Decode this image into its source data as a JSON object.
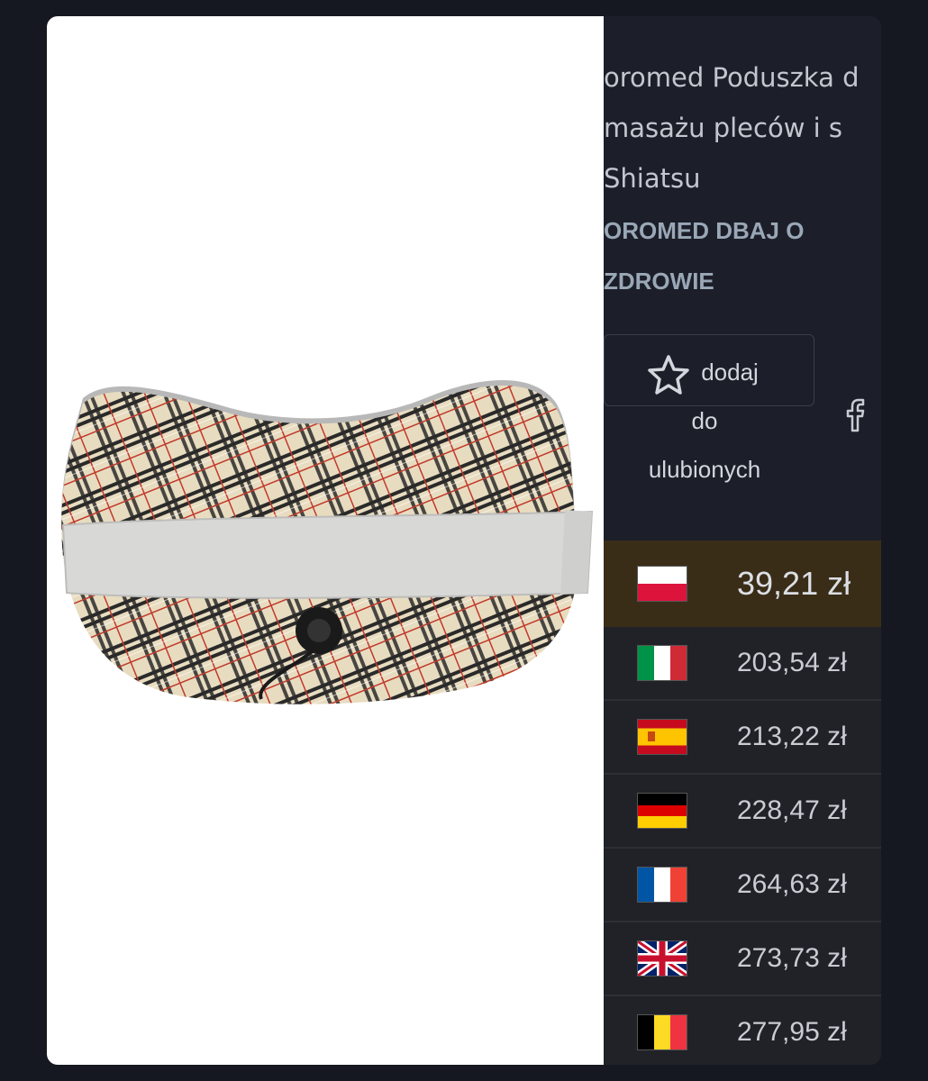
{
  "product": {
    "title_lines": [
      "oromed Poduszka d",
      "masażu pleców i s",
      "Shiatsu"
    ],
    "brand_lines": [
      "OROMED DBAJ O",
      "ZDROWIE"
    ]
  },
  "actions": {
    "favorite_lines": [
      "dodaj",
      "do",
      "ulubionych"
    ],
    "star_icon": "star-outline-icon",
    "share_icon": "facebook-icon"
  },
  "prices": [
    {
      "country": "Poland",
      "flag": "pl",
      "price": "39,21 zł",
      "active": true
    },
    {
      "country": "Italy",
      "flag": "it",
      "price": "203,54 zł"
    },
    {
      "country": "Spain",
      "flag": "es",
      "price": "213,22 zł"
    },
    {
      "country": "Germany",
      "flag": "de",
      "price": "228,47 zł"
    },
    {
      "country": "France",
      "flag": "fr",
      "price": "264,63 zł"
    },
    {
      "country": "United Kingdom",
      "flag": "gb",
      "price": "273,73 zł"
    },
    {
      "country": "Belgium",
      "flag": "be",
      "price": "277,95 zł"
    }
  ],
  "colors": {
    "page_bg": "#161821",
    "info_bg": "#1c1f29",
    "active_row_bg": "#3a2d18",
    "row_bg": "#202228"
  }
}
